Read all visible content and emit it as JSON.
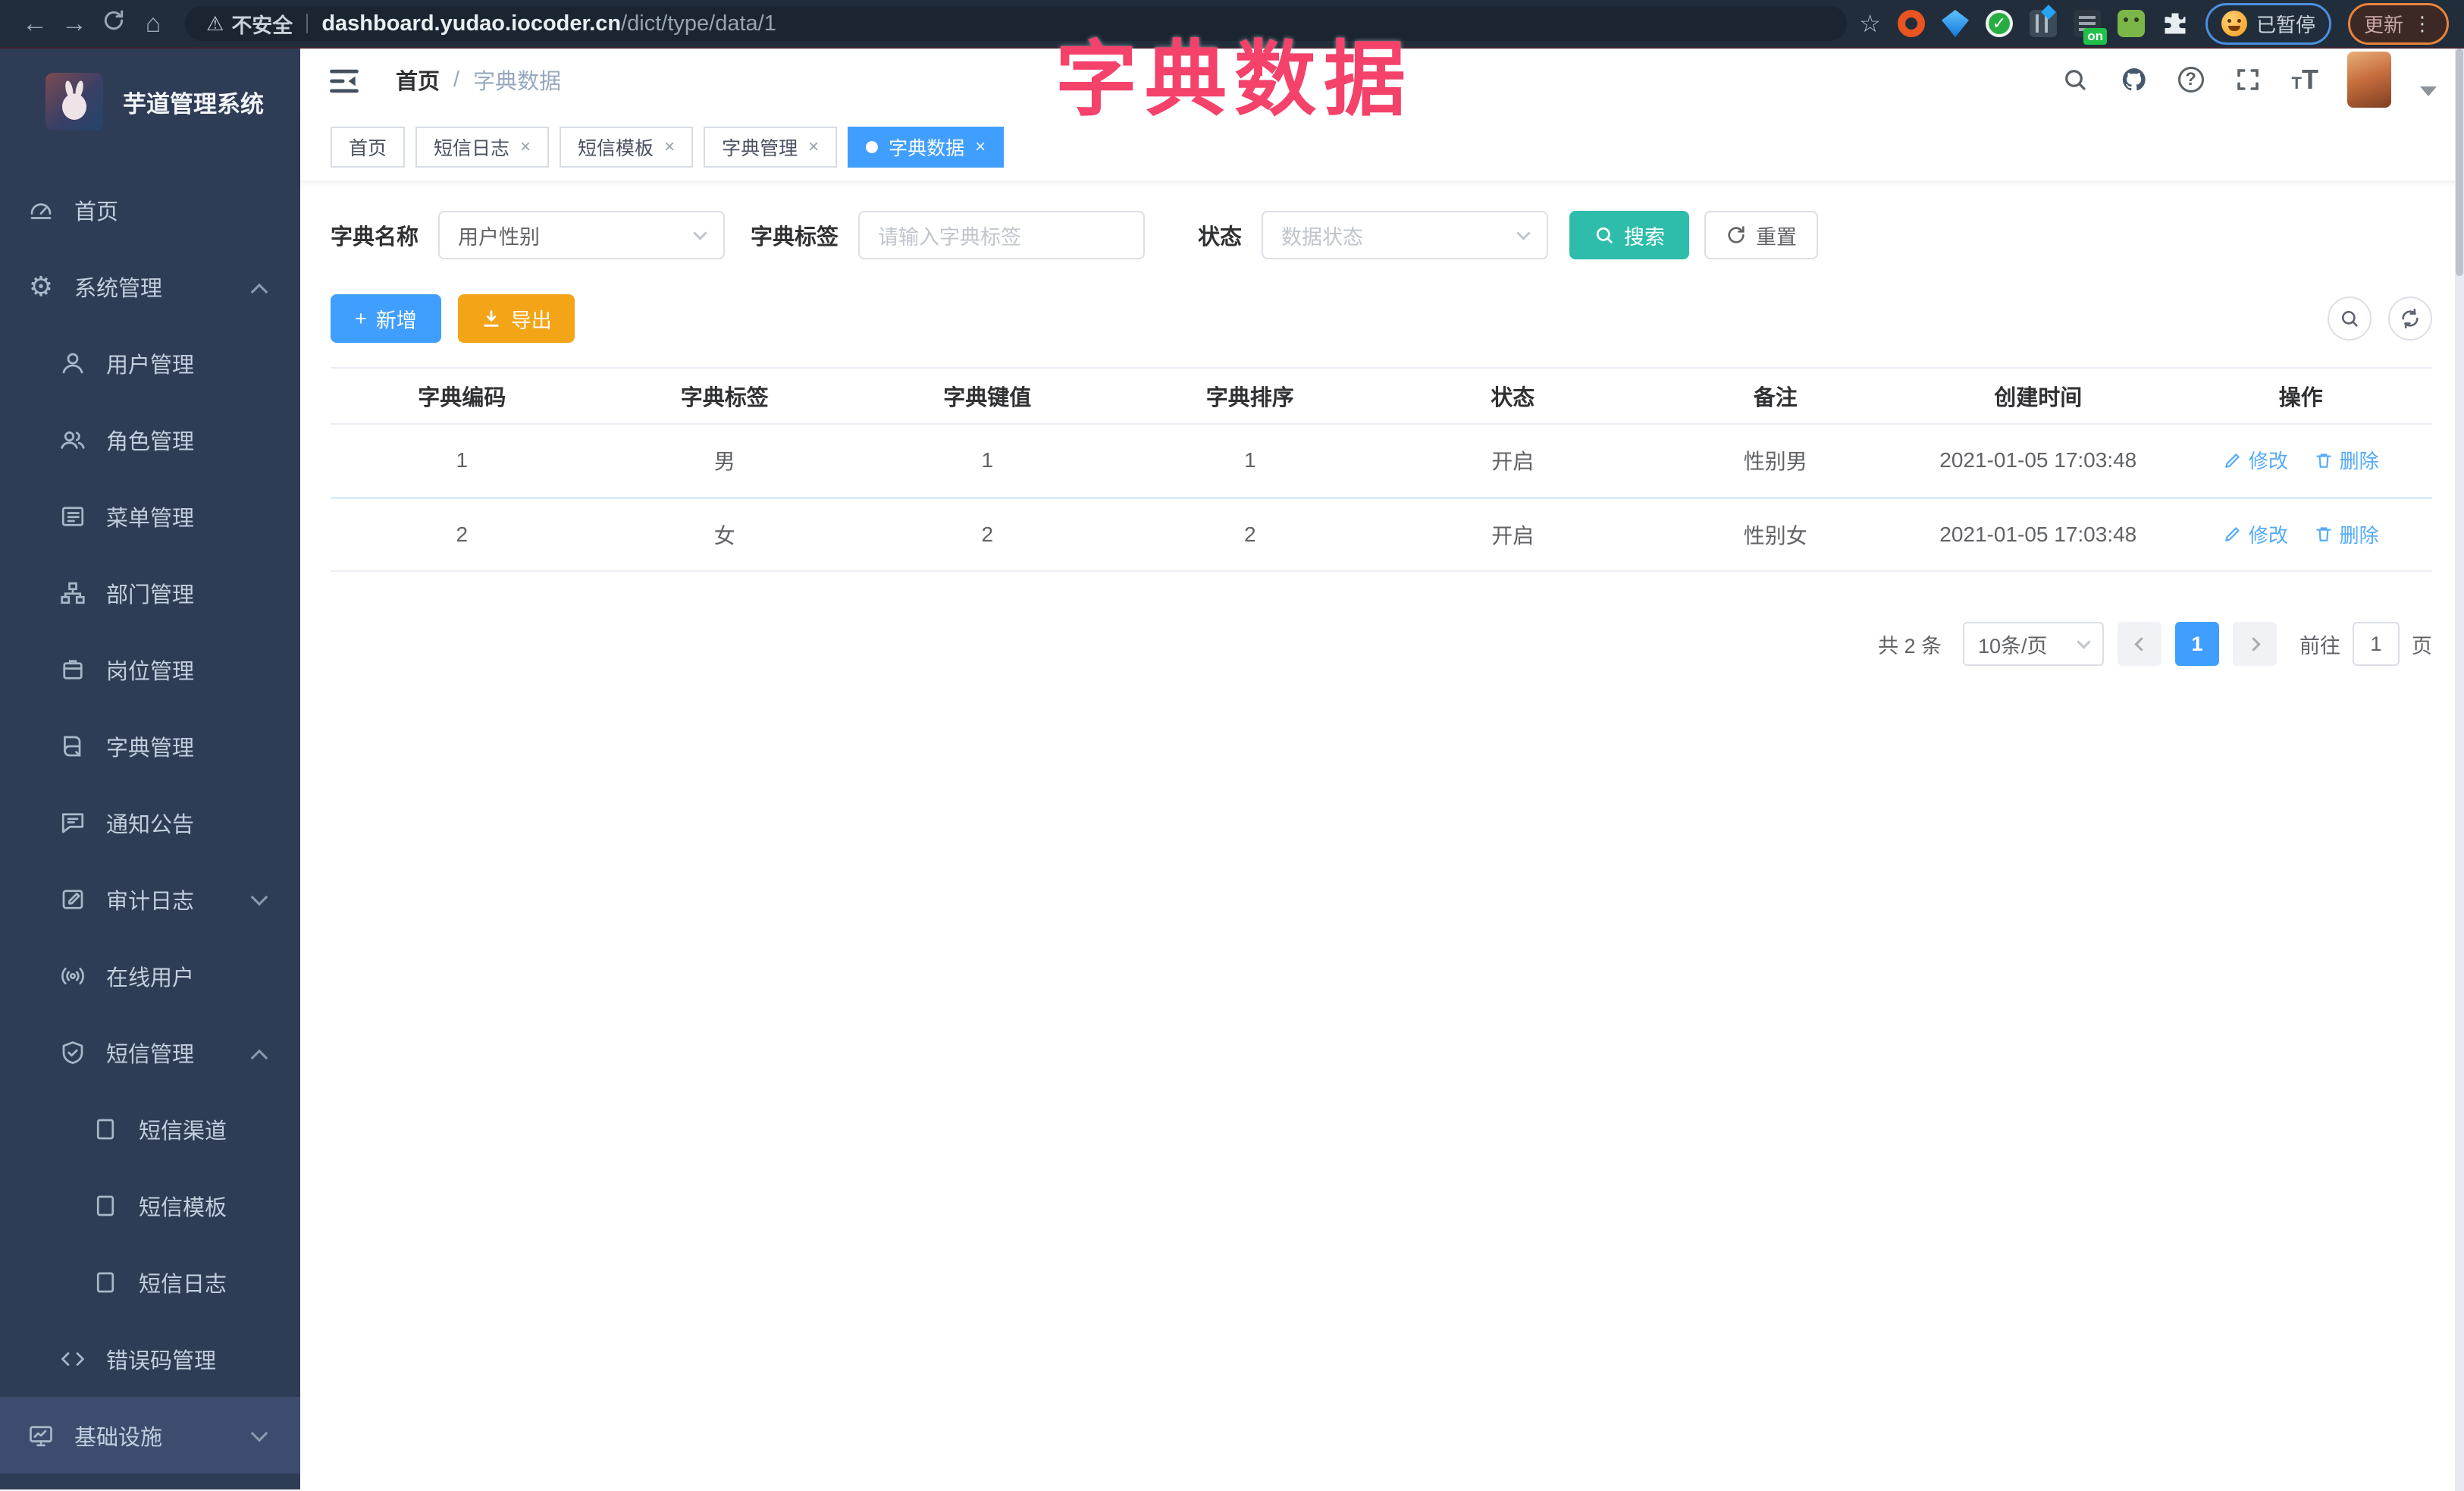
{
  "browser": {
    "security_label": "不安全",
    "url_host": "dashboard.yudao.iocoder.cn",
    "url_path": "/dict/type/data/1",
    "extension_on_badge": "on",
    "paused_badge": "已暂停",
    "update_button": "更新"
  },
  "overlay_title": "字典数据",
  "sidebar": {
    "app_title": "芋道管理系统",
    "items": [
      {
        "label": "首页",
        "icon": "dashboard-icon"
      },
      {
        "label": "系统管理",
        "icon": "gear-icon",
        "state": "expanded"
      },
      {
        "label": "用户管理",
        "icon": "user-icon"
      },
      {
        "label": "角色管理",
        "icon": "users-icon"
      },
      {
        "label": "菜单管理",
        "icon": "menu-list-icon"
      },
      {
        "label": "部门管理",
        "icon": "org-tree-icon"
      },
      {
        "label": "岗位管理",
        "icon": "post-badge-icon"
      },
      {
        "label": "字典管理",
        "icon": "dictionary-icon"
      },
      {
        "label": "通知公告",
        "icon": "announcement-icon"
      },
      {
        "label": "审计日志",
        "icon": "audit-log-icon",
        "state": "collapsed"
      },
      {
        "label": "在线用户",
        "icon": "online-users-icon"
      },
      {
        "label": "短信管理",
        "icon": "shield-check-icon",
        "state": "expanded"
      },
      {
        "label": "短信渠道",
        "icon": "document-icon"
      },
      {
        "label": "短信模板",
        "icon": "document-icon"
      },
      {
        "label": "短信日志",
        "icon": "document-icon"
      },
      {
        "label": "错误码管理",
        "icon": "code-icon"
      },
      {
        "label": "基础设施",
        "icon": "monitor-icon",
        "state": "collapsed"
      }
    ]
  },
  "header": {
    "breadcrumb": {
      "home": "首页",
      "separator": "/",
      "current": "字典数据"
    }
  },
  "tabs": [
    {
      "label": "首页"
    },
    {
      "label": "短信日志",
      "close": "×"
    },
    {
      "label": "短信模板",
      "close": "×"
    },
    {
      "label": "字典管理",
      "close": "×"
    },
    {
      "label": "字典数据",
      "close": "×",
      "active": true
    }
  ],
  "filters": {
    "name_label": "字典名称",
    "name_value": "用户性别",
    "tag_label": "字典标签",
    "tag_placeholder": "请输入字典标签",
    "status_label": "状态",
    "status_placeholder": "数据状态",
    "search_label": "搜索",
    "reset_label": "重置"
  },
  "toolbar": {
    "add_label": "新增",
    "add_prefix": "+",
    "export_label": "导出"
  },
  "table": {
    "columns": [
      "字典编码",
      "字典标签",
      "字典键值",
      "字典排序",
      "状态",
      "备注",
      "创建时间",
      "操作"
    ],
    "rows": [
      {
        "cells": [
          "1",
          "男",
          "1",
          "1",
          "开启",
          "性别男",
          "2021-01-05 17:03:48"
        ],
        "actions": [
          "修改",
          "删除"
        ]
      },
      {
        "cells": [
          "2",
          "女",
          "2",
          "2",
          "开启",
          "性别女",
          "2021-01-05 17:03:48"
        ],
        "actions": [
          "修改",
          "删除"
        ]
      }
    ]
  },
  "pagination": {
    "total": "共 2 条",
    "page_size": "10条/页",
    "current_page": "1",
    "goto_label": "前往",
    "goto_value": "1",
    "page_unit": "页"
  },
  "colors": {
    "accent_blue": "#409eff",
    "search_teal": "#2dbdaa",
    "export_orange": "#f3a417",
    "overlay_pink": "#f4426a",
    "sidebar_bg": "#2f3c55"
  }
}
